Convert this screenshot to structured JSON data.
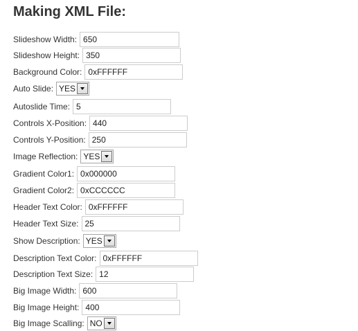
{
  "title": "Making XML File:",
  "fields": {
    "slideshow_width": {
      "label": "Slideshow Width:",
      "value": "650"
    },
    "slideshow_height": {
      "label": "Slideshow Height:",
      "value": "350"
    },
    "background_color": {
      "label": "Background Color:",
      "value": "0xFFFFFF"
    },
    "auto_slide": {
      "label": "Auto Slide:",
      "value": "YES"
    },
    "autoslide_time": {
      "label": "Autoslide Time:",
      "value": "5"
    },
    "controls_x": {
      "label": "Controls X-Position:",
      "value": "440"
    },
    "controls_y": {
      "label": "Controls Y-Position:",
      "value": "250"
    },
    "image_reflection": {
      "label": "Image Reflection:",
      "value": "YES"
    },
    "gradient_color1": {
      "label": "Gradient Color1:",
      "value": "0x000000"
    },
    "gradient_color2": {
      "label": "Gradient Color2:",
      "value": "0xCCCCCC"
    },
    "header_text_color": {
      "label": "Header Text Color:",
      "value": "0xFFFFFF"
    },
    "header_text_size": {
      "label": "Header Text Size:",
      "value": "25"
    },
    "show_description": {
      "label": "Show Description:",
      "value": "YES"
    },
    "description_text_color": {
      "label": "Description Text Color:",
      "value": "0xFFFFFF"
    },
    "description_text_size": {
      "label": "Description Text Size:",
      "value": "12"
    },
    "big_image_width": {
      "label": "Big Image Width:",
      "value": "600"
    },
    "big_image_height": {
      "label": "Big Image Height:",
      "value": "400"
    },
    "big_image_scaling": {
      "label": "Big Image Scalling:",
      "value": "NO"
    }
  }
}
